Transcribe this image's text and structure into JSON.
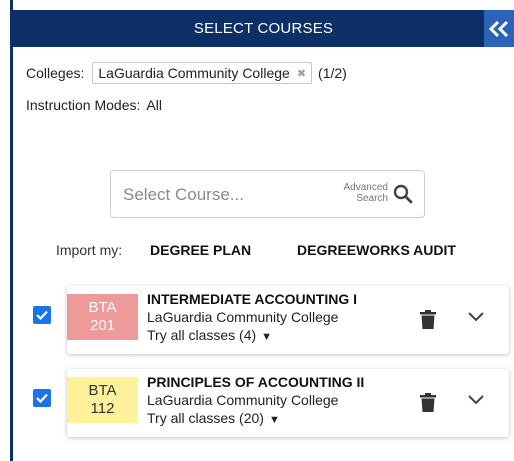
{
  "header": {
    "title": "SELECT COURSES",
    "collapse_icon": "double-chevron-left-icon"
  },
  "filters": {
    "colleges_label": "Colleges:",
    "college_chip": "LaGuardia Community College",
    "college_count": "(1/2)",
    "modes_label": "Instruction Modes:",
    "modes_value": "All"
  },
  "search": {
    "placeholder": "Select Course...",
    "advanced_line1": "Advanced",
    "advanced_line2": "Search",
    "icon": "search-icon"
  },
  "import": {
    "label": "Import my:",
    "degree_plan": "DEGREE PLAN",
    "degreeworks": "DEGREEWORKS AUDIT"
  },
  "courses": [
    {
      "subject": "BTA",
      "number": "201",
      "title": "INTERMEDIATE ACCOUNTING I",
      "college": "LaGuardia Community College",
      "classes": "Try all classes (4)",
      "color": "#ec9a9a",
      "checked": true
    },
    {
      "subject": "BTA",
      "number": "112",
      "title": "PRINCIPLES OF ACCOUNTING II",
      "college": "LaGuardia Community College",
      "classes": "Try all classes (20)",
      "color": "#fdf29a",
      "checked": true
    }
  ],
  "colors": {
    "header_bg": "#0b2f66",
    "accent": "#2b63b8",
    "checkbox": "#1a73e8"
  }
}
